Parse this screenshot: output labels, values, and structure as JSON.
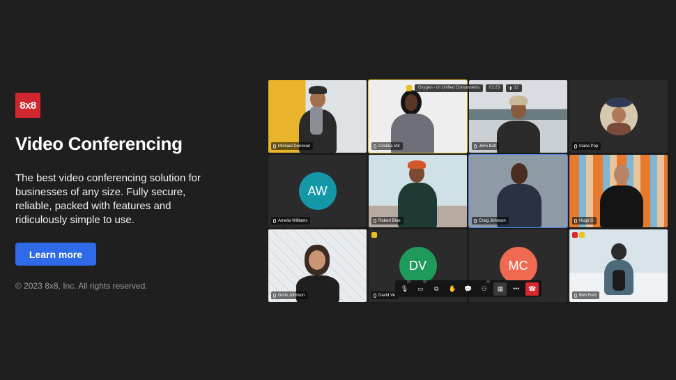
{
  "brand": {
    "logo_text": "8x8",
    "logo_color": "#d0262f"
  },
  "hero": {
    "title": "Video Conferencing",
    "description": "The best video conferencing solution for businesses of any size. Fully secure, reliable, packed with features and ridiculously simple to use.",
    "cta_label": "Learn more",
    "copyright": "© 2023 8x8, Inc. All rights reserved."
  },
  "meeting": {
    "room_name": "Oxygen - UI Unified Components",
    "timer": "01:23",
    "participant_count": "12",
    "participants": [
      {
        "name": "Michael Donovan"
      },
      {
        "name": "Cristina Vot"
      },
      {
        "name": "John Bolt"
      },
      {
        "name": "Ioana Pop"
      },
      {
        "name": "Amelia Williams",
        "initials": "AW",
        "color": "#1497a7"
      },
      {
        "name": "Robert Blue"
      },
      {
        "name": "Craig Johnson"
      },
      {
        "name": "Hugo G"
      },
      {
        "name": "Doris Johnson"
      },
      {
        "name": "David Ve",
        "initials": "DV",
        "color": "#1f9a5b"
      },
      {
        "name": "",
        "initials": "MC",
        "color": "#f06a52"
      },
      {
        "name": "Bob Ford"
      }
    ]
  },
  "colors": {
    "accent": "#2f6be8",
    "active_border": "#e9c21f",
    "hangup": "#d9262f"
  }
}
